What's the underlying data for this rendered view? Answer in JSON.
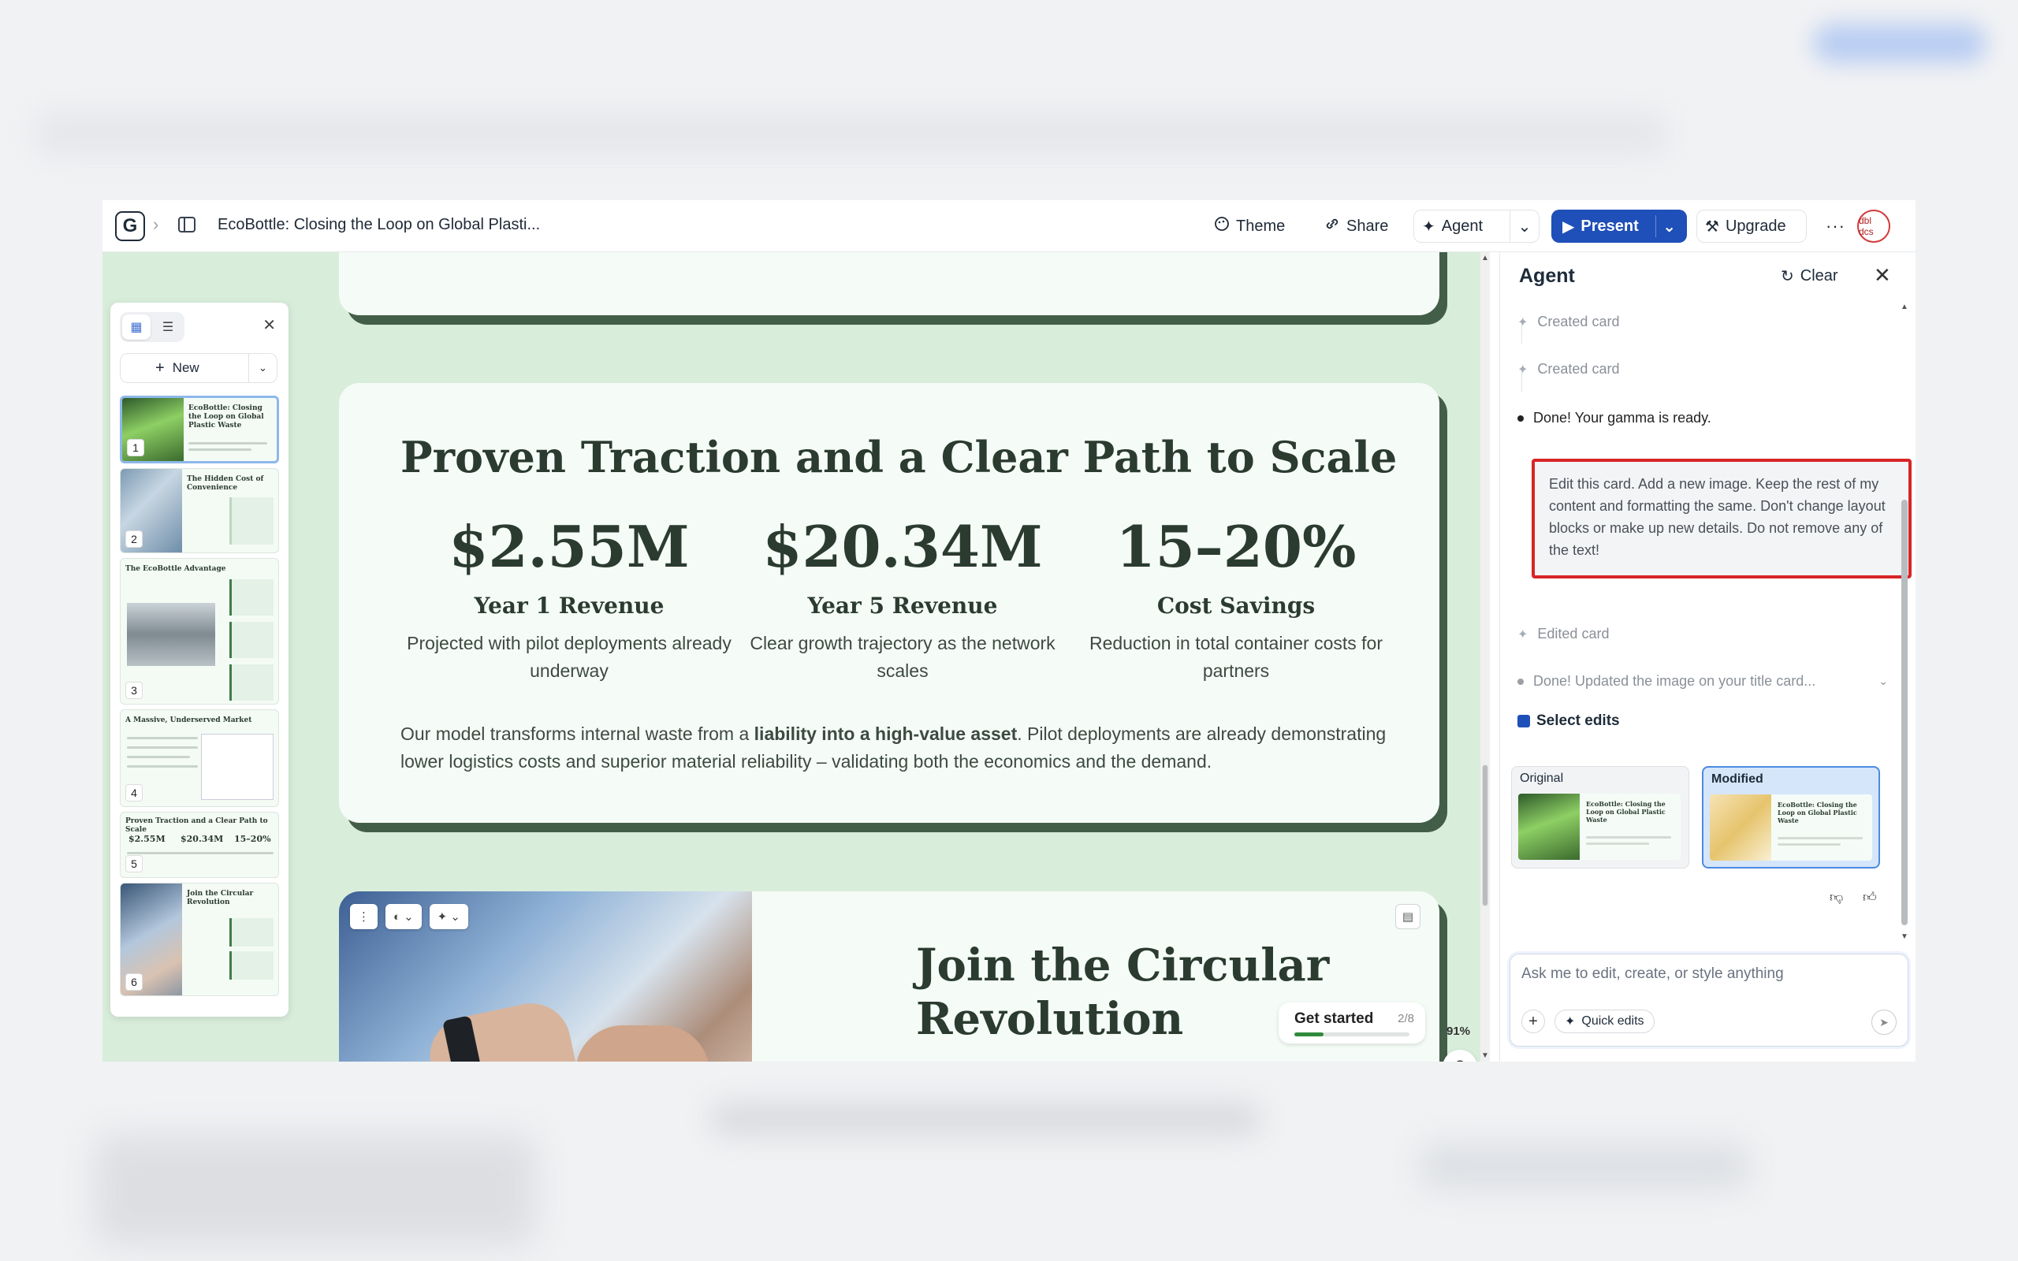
{
  "app": {
    "doc_title": "EcoBottle: Closing the Loop on Global Plasti...",
    "avatar_text": "dbl dcs"
  },
  "toolbar": {
    "theme_label": "Theme",
    "share_label": "Share",
    "agent_label": "Agent",
    "present_label": "Present",
    "upgrade_label": "Upgrade",
    "more_label": "···"
  },
  "sidebar": {
    "new_label": "New",
    "thumbnails": [
      {
        "num": "1",
        "title": "EcoBottle: Closing the Loop on Global Plastic Waste"
      },
      {
        "num": "2",
        "title": "The Hidden Cost of Convenience"
      },
      {
        "num": "3",
        "title": "The EcoBottle Advantage"
      },
      {
        "num": "4",
        "title": "A Massive, Underserved Market"
      },
      {
        "num": "5",
        "title": "Proven Traction and a Clear Path to Scale",
        "stats": [
          "$2.55M",
          "$20.34M",
          "15–20%"
        ]
      },
      {
        "num": "6",
        "title": "Join the Circular Revolution"
      }
    ]
  },
  "card": {
    "title": "Proven Traction and a Clear Path to Scale",
    "stats": [
      {
        "value": "$2.55M",
        "label": "Year 1 Revenue",
        "desc": "Projected with pilot deployments already underway"
      },
      {
        "value": "$20.34M",
        "label": "Year 5 Revenue",
        "desc": "Clear growth trajectory as the network scales"
      },
      {
        "value": "15–20%",
        "label": "Cost Savings",
        "desc": "Reduction in total container costs for partners"
      }
    ],
    "body_pre": "Our model transforms internal waste from a ",
    "body_bold": "liability into a high-value asset",
    "body_post": ". Pilot deployments are already demonstrating lower logistics costs and superior material reliability – validating both the economics and the demand."
  },
  "next_card": {
    "title_line1": "Join the Circular",
    "title_line2": "Revolution"
  },
  "get_started": {
    "label": "Get started",
    "count": "2/8",
    "progress": 0.25
  },
  "zoom": "91%",
  "help_label": "?",
  "agent": {
    "title": "Agent",
    "clear_label": "Clear",
    "steps": [
      {
        "text": "Created card"
      },
      {
        "text": "Created card"
      },
      {
        "text": "Done! Your gamma is ready."
      }
    ],
    "user_message": "Edit this card. Add a new image. Keep the rest of my content and formatting the same. Don't change layout blocks or make up new details. Do not remove any of the text!",
    "edited_step": "Edited card",
    "done_updated": "Done! Updated the image on your title card...",
    "select_edits_label": "Select edits",
    "original_label": "Original",
    "modified_label": "Modified",
    "preview_title": "EcoBottle: Closing the Loop on Global Plastic Waste",
    "composer_placeholder": "Ask me to edit, create, or style anything",
    "quick_edits_label": "Quick edits"
  },
  "colors": {
    "brand_blue": "#1f4fb8",
    "card_green": "#435e48",
    "canvas_bg": "#d9eddb",
    "highlight_red": "#d82527"
  }
}
